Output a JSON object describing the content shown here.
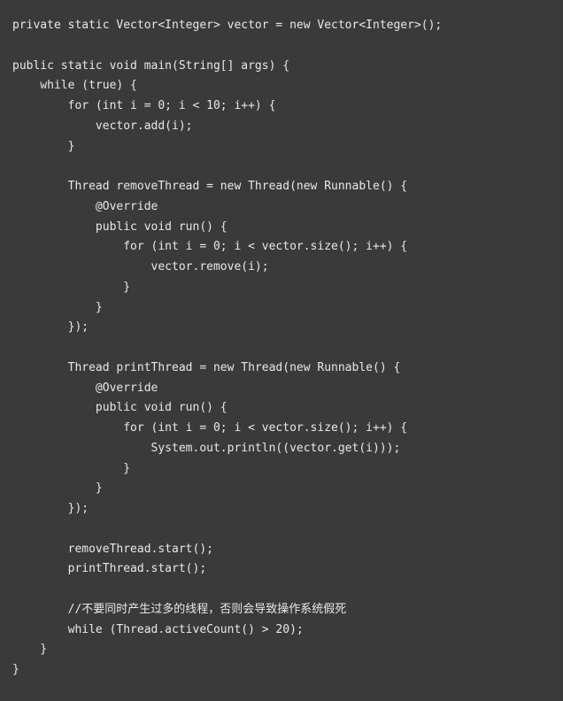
{
  "code": {
    "lines": [
      "private static Vector<Integer> vector = new Vector<Integer>();",
      "",
      "public static void main(String[] args) {",
      "    while (true) {",
      "        for (int i = 0; i < 10; i++) {",
      "            vector.add(i);",
      "        }",
      "",
      "        Thread removeThread = new Thread(new Runnable() {",
      "            @Override",
      "            public void run() {",
      "                for (int i = 0; i < vector.size(); i++) {",
      "                    vector.remove(i);",
      "                }",
      "            }",
      "        });",
      "",
      "        Thread printThread = new Thread(new Runnable() {",
      "            @Override",
      "            public void run() {",
      "                for (int i = 0; i < vector.size(); i++) {",
      "                    System.out.println((vector.get(i)));",
      "                }",
      "            }",
      "        });",
      "",
      "        removeThread.start();",
      "        printThread.start();",
      "",
      "        //不要同时产生过多的线程，否则会导致操作系统假死",
      "        while (Thread.activeCount() > 20);",
      "    }",
      "}"
    ]
  }
}
